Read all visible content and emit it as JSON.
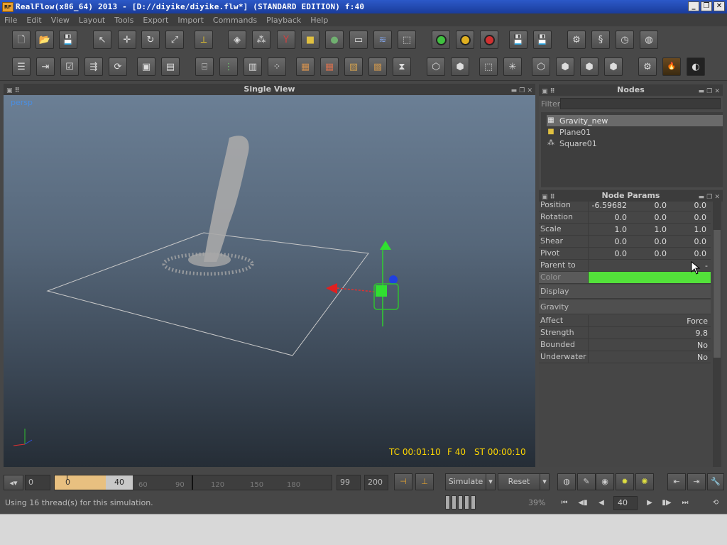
{
  "window": {
    "title": "RealFlow(x86_64) 2013 - [D://diyike/diyike.flw*] (STANDARD EDITION) f:40",
    "app_icon_text": "RF"
  },
  "menu": [
    "File",
    "Edit",
    "View",
    "Layout",
    "Tools",
    "Export",
    "Import",
    "Commands",
    "Playback",
    "Help"
  ],
  "viewport": {
    "title": "Single View",
    "camera": "persp",
    "timecode": "TC 00:01:10",
    "frame": "F 40",
    "sim_time": "ST 00:00:10"
  },
  "nodes_panel": {
    "title": "Nodes",
    "filter_label": "Filter",
    "filter_value": "",
    "items": [
      {
        "name": "Gravity_new",
        "icon": "gravity-icon",
        "selected": true
      },
      {
        "name": "Plane01",
        "icon": "object-icon",
        "selected": false
      },
      {
        "name": "Square01",
        "icon": "emitter-icon",
        "selected": false
      }
    ]
  },
  "params_panel": {
    "title": "Node Params",
    "rows": [
      {
        "label": "Position",
        "v": [
          "-6.59682",
          "0.0",
          "0.0"
        ]
      },
      {
        "label": "Rotation",
        "v": [
          "0.0",
          "0.0",
          "0.0"
        ]
      },
      {
        "label": "Scale",
        "v": [
          "1.0",
          "1.0",
          "1.0"
        ]
      },
      {
        "label": "Shear",
        "v": [
          "0.0",
          "0.0",
          "0.0"
        ]
      },
      {
        "label": "Pivot",
        "v": [
          "0.0",
          "0.0",
          "0.0"
        ]
      }
    ],
    "parent_to": {
      "label": "Parent to",
      "value": "-"
    },
    "color": {
      "label": "Color",
      "value": "#53e23a"
    },
    "sections": {
      "display": "Display",
      "gravity": "Gravity"
    },
    "gravity_rows": [
      {
        "label": "Affect",
        "value": "Force"
      },
      {
        "label": "Strength",
        "value": "9.8"
      },
      {
        "label": "Bounded",
        "value": "No"
      },
      {
        "label": "Underwater",
        "value": "No"
      }
    ]
  },
  "timeline": {
    "start": "0",
    "range_start": "0",
    "range_end": "40",
    "ticks": [
      "60",
      "90",
      "120",
      "150",
      "180"
    ],
    "end_a": "99",
    "end_b": "200",
    "simulate_label": "Simulate",
    "reset_label": "Reset"
  },
  "status": {
    "message": "Using 16 thread(s) for this simulation.",
    "percent": "39%",
    "current_frame": "40"
  }
}
